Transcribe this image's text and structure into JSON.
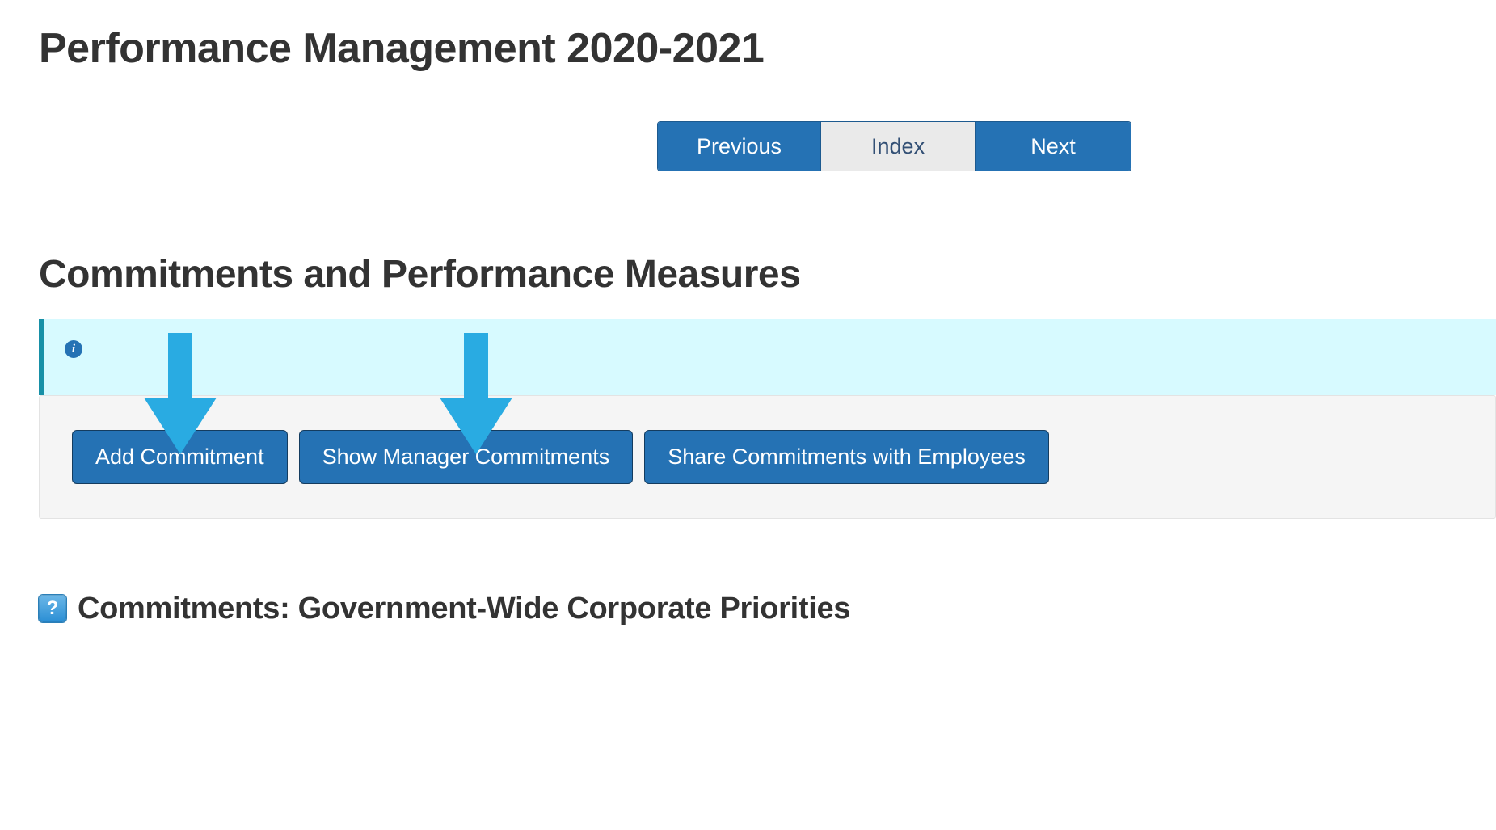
{
  "header": {
    "title": "Performance Management 2020-2021"
  },
  "pager": {
    "previous": "Previous",
    "index": "Index",
    "next": "Next"
  },
  "section": {
    "title": "Commitments and Performance Measures"
  },
  "info_bar": {
    "icon_name": "info-icon"
  },
  "buttons": {
    "add_commitment": "Add Commitment",
    "show_manager_commitments": "Show Manager Commitments",
    "share_commitments": "Share Commitments with Employees"
  },
  "subsection": {
    "title": "Commitments: Government-Wide Corporate Priorities"
  },
  "annotations": {
    "arrow_color": "#29abe2"
  }
}
